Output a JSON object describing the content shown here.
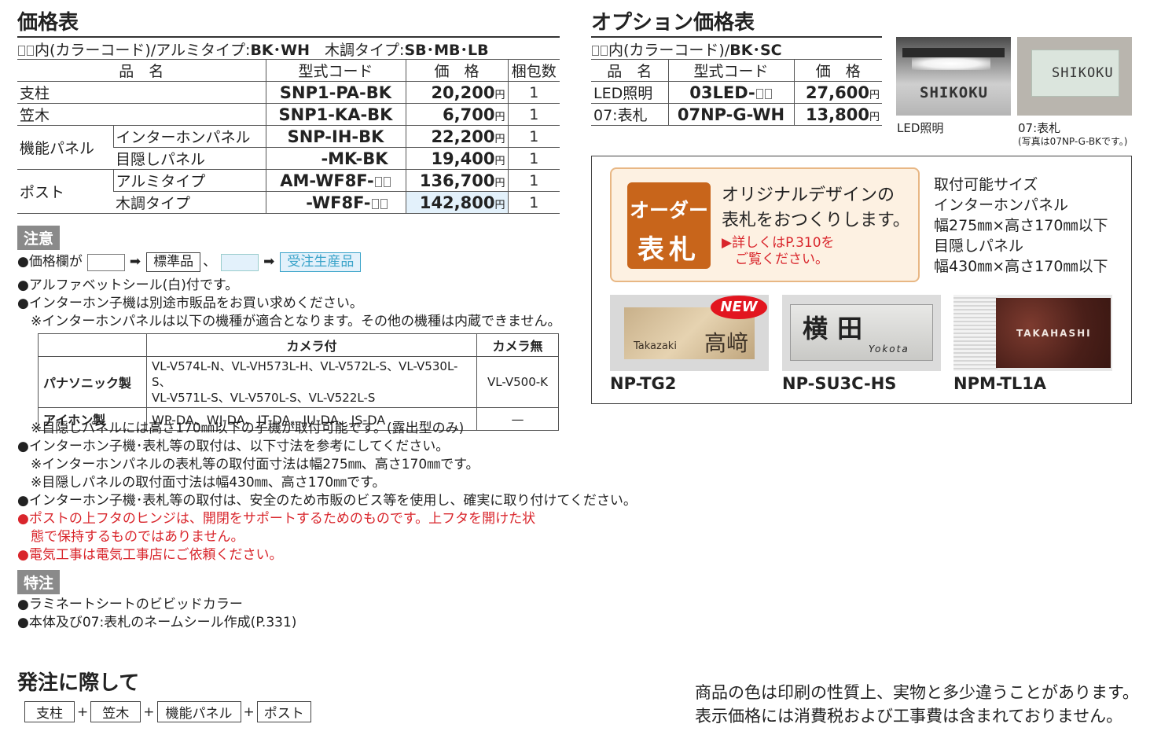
{
  "price_table": {
    "title": "価格表",
    "color_note": "内(カラーコード)/アルミタイプ:",
    "alumi_codes": "BK･WH",
    "wood_label": "木調タイプ:",
    "wood_codes": "SB･MB･LB",
    "headers": [
      "品　名",
      "型式コード",
      "価　格",
      "梱包数"
    ],
    "rows": [
      {
        "name": "支柱",
        "code": "SNP1-PA-BK",
        "price": "20,200",
        "qty": "1"
      },
      {
        "name": "笠木",
        "code": "SNP1-KA-BK",
        "price": "6,700",
        "qty": "1"
      }
    ],
    "kinou": {
      "group": "機能パネル",
      "rows": [
        {
          "sub": "インターホンパネル",
          "code": "SNP-IH-BK",
          "price": "22,200",
          "qty": "1"
        },
        {
          "sub": "目隠しパネル",
          "code": "-MK-BK",
          "price": "19,400",
          "qty": "1"
        }
      ]
    },
    "post": {
      "group": "ポスト",
      "rows": [
        {
          "sub": "アルミタイプ",
          "code": "AM-WF8F-",
          "price": "136,700",
          "qty": "1"
        },
        {
          "sub": "木調タイプ",
          "code": "-WF8F-",
          "price": "142,800",
          "qty": "1"
        }
      ]
    },
    "yen": "円"
  },
  "notes": {
    "label": "注意",
    "legend_prefix": "●価格欄が",
    "standard": "標準品",
    "made_to_order": "受注生産品",
    "arrow": "➡",
    "comma": "、",
    "lines": [
      "●アルファベットシール(白)付です。",
      "●インターホン子機は別途市販品をお買い求めください。",
      "　※インターホンパネルは以下の機種が適合となります。その他の機種は内蔵できません。"
    ],
    "maker_table": {
      "headers": [
        "",
        "カメラ付",
        "カメラ無"
      ],
      "rows": [
        {
          "maker": "パナソニック製",
          "with_cam_1": "VL-V574L-N、VL-VH573L-H、VL-V572L-S、VL-V530L-S、",
          "with_cam_2": "VL-V571L-S、VL-V570L-S、VL-V522L-S",
          "without_cam": "VL-V500-K"
        },
        {
          "maker": "アイホン製",
          "with_cam_1": "WP-DA、WJ-DA、JT-DA、JU-DA、JS-DA",
          "without_cam": "—"
        }
      ]
    },
    "lines2": [
      "　※目隠しパネルには高さ170㎜以下の子機が取付可能です。(露出型のみ)",
      "●インターホン子機･表札等の取付は、以下寸法を参考にしてください。",
      "　※インターホンパネルの表札等の取付面寸法は幅275㎜、高さ170㎜です。",
      "　※目隠しパネルの取付面寸法は幅430㎜、高さ170㎜です。",
      "●インターホン子機･表札等の取付は、安全のため市販のビス等を使用し、確実に取り付けてください。"
    ],
    "red_lines": [
      "●ポストの上フタのヒンジは、開閉をサポートするためのものです。上フタを開けた状",
      "　態で保持するものではありません。",
      "●電気工事は電気工事店にご依頼ください。"
    ]
  },
  "special": {
    "label": "特注",
    "lines": [
      "●ラミネートシートのビビッドカラー",
      "●本体及び07:表札のネームシール作成(P.331)"
    ]
  },
  "order": {
    "title": "発注に際して",
    "items": [
      "支柱",
      "笠木",
      "機能パネル",
      "ポスト"
    ],
    "plus": "+"
  },
  "disclaimer": [
    "商品の色は印刷の性質上、実物と多少違うことがあります。",
    "表示価格には消費税および工事費は含まれておりません。"
  ],
  "option": {
    "title": "オプション価格表",
    "color_note": "内(カラーコード)/",
    "codes": "BK･SC",
    "headers": [
      "品　名",
      "型式コード",
      "価　格"
    ],
    "rows": [
      {
        "name": "LED照明",
        "code": "03LED-",
        "price": "27,600"
      },
      {
        "name": "07:表札",
        "code": "07NP-G-WH",
        "price": "13,800"
      }
    ],
    "photo1_caption": "LED照明",
    "photo2_caption": "07:表札",
    "photo2_sub": "(写真は07NP-G-BKです。)",
    "photo1_sign": "SHIKOKU",
    "photo2_sign": "SHIKOKU"
  },
  "order_sign": {
    "badge_1": "オーダー",
    "badge_2": "表札",
    "text_1": "オリジナルデザインの",
    "text_2": "表札をおつくりします。",
    "link_1": "▶詳しくはP.310を",
    "link_2": "　ご覧ください。",
    "size_lines": [
      "取付可能サイズ",
      "インターホンパネル",
      "幅275㎜×高さ170㎜以下",
      "目隠しパネル",
      "幅430㎜×高さ170㎜以下"
    ]
  },
  "nameplates": [
    {
      "model": "NP-TG2",
      "sign_latin": "Takazaki",
      "sign_kanji": "高﨑",
      "badge": "NEW"
    },
    {
      "model": "NP-SU3C-HS",
      "sign_kanji": "横田",
      "sign_latin": "Yokota"
    },
    {
      "model": "NPM-TL1A",
      "sign_latin": "TAKAHASHI"
    }
  ],
  "colors": {
    "accent_orange": "#c8651b",
    "order_bg": "#fdf1e2",
    "made_to_order_bg": "#e3f1fb",
    "note_red": "#d9262c",
    "label_gray": "#8a8a8a"
  }
}
